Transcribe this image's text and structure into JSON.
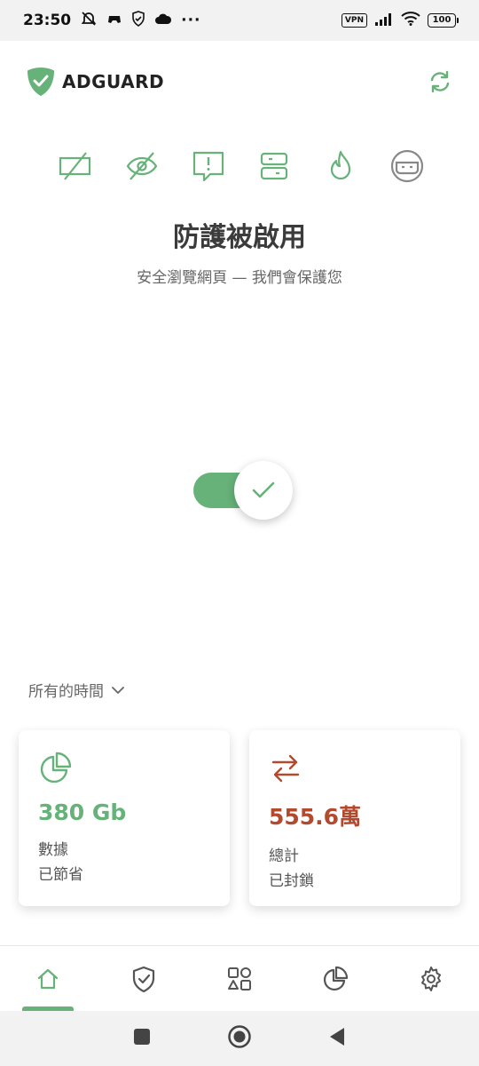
{
  "status_bar": {
    "time": "23:50",
    "more": "···",
    "vpn_label": "VPN",
    "battery_level": "100"
  },
  "header": {
    "logo_text": "ADGUARD"
  },
  "protection": {
    "title": "防護被啟用",
    "subtitle": "安全瀏覽網頁 — 我們會保護您",
    "enabled": true
  },
  "stats": {
    "period_label": "所有的時間",
    "data_saved": {
      "value": "380 Gb",
      "label_line1": "數據",
      "label_line2": "已節省"
    },
    "blocked": {
      "value": "555.6萬",
      "label_line1": "總計",
      "label_line2": "已封鎖"
    }
  },
  "colors": {
    "accent": "#67b279",
    "blocked": "#b24a2e"
  },
  "bottom_nav": {
    "active": "home"
  }
}
